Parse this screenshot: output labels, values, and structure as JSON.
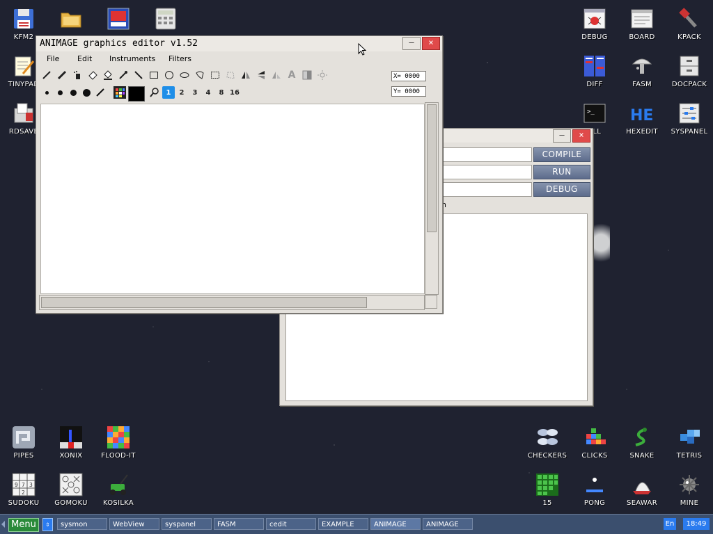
{
  "desktop_icons_left": [
    {
      "label": "KFM2",
      "icon": "floppy-icon"
    },
    {
      "label": "TINYPAD",
      "icon": "notepad-icon"
    },
    {
      "label": "RDSAVE",
      "icon": "save-icon"
    },
    {
      "label": "PIPES",
      "icon": "pipes-icon"
    },
    {
      "label": "SUDOKU",
      "icon": "sudoku-icon"
    }
  ],
  "desktop_icons_top": [
    {
      "label": "",
      "icon": "folder-icon"
    },
    {
      "label": "",
      "icon": "picture-icon"
    },
    {
      "label": "",
      "icon": "calculator-icon"
    }
  ],
  "desktop_icons_bottom_left": [
    {
      "label": "XONIX",
      "icon": "xonix-icon"
    },
    {
      "label": "FLOOD-IT",
      "icon": "flood-icon"
    },
    {
      "label": "GOMOKU",
      "icon": "gomoku-icon"
    },
    {
      "label": "KOSILKA",
      "icon": "mower-icon"
    }
  ],
  "desktop_icons_right": [
    {
      "label": "DEBUG",
      "icon": "debug-icon"
    },
    {
      "label": "BOARD",
      "icon": "board-icon"
    },
    {
      "label": "KPACK",
      "icon": "kpack-icon"
    },
    {
      "label": "DIFF",
      "icon": "diff-icon"
    },
    {
      "label": "FASM",
      "icon": "fasm-icon"
    },
    {
      "label": "DOCPACK",
      "icon": "docpack-icon"
    },
    {
      "label": "ELL",
      "icon": "shell-icon"
    },
    {
      "label": "HEXEDIT",
      "icon": "hexedit-icon"
    },
    {
      "label": "SYSPANEL",
      "icon": "syspanel-icon"
    }
  ],
  "desktop_icons_bottom_right": [
    {
      "label": "CHECKERS",
      "icon": "checkers-icon"
    },
    {
      "label": "CLICKS",
      "icon": "clicks-icon"
    },
    {
      "label": "SNAKE",
      "icon": "snake-icon"
    },
    {
      "label": "TETRIS",
      "icon": "tetris-icon"
    },
    {
      "label": "15",
      "icon": "fifteen-icon"
    },
    {
      "label": "PONG",
      "icon": "pong-icon"
    },
    {
      "label": "SEAWAR",
      "icon": "seawar-icon"
    },
    {
      "label": "MINE",
      "icon": "mine-icon"
    }
  ],
  "animage": {
    "title": "ANIMAGE graphics editor v1.52",
    "menu": [
      "File",
      "Edit",
      "Instruments",
      "Filters"
    ],
    "coord_x": "X= 0000",
    "coord_y": "Y= 0000",
    "zoom_levels": [
      "1",
      "2",
      "3",
      "4",
      "8",
      "16"
    ],
    "selected_zoom": "1",
    "colors": {
      "primary": "#000000"
    }
  },
  "fasm_window": {
    "buttons": [
      "COMPILE",
      "RUN",
      "DEBUG"
    ],
    "partial_label": "n"
  },
  "taskbar": {
    "menu_label": "Menu",
    "tasks": [
      "sysmon",
      "WebView",
      "syspanel",
      "FASM",
      "cedit",
      "EXAMPLE",
      "ANIMAGE",
      "ANIMAGE"
    ],
    "lang": "En",
    "clock": "18:49"
  }
}
